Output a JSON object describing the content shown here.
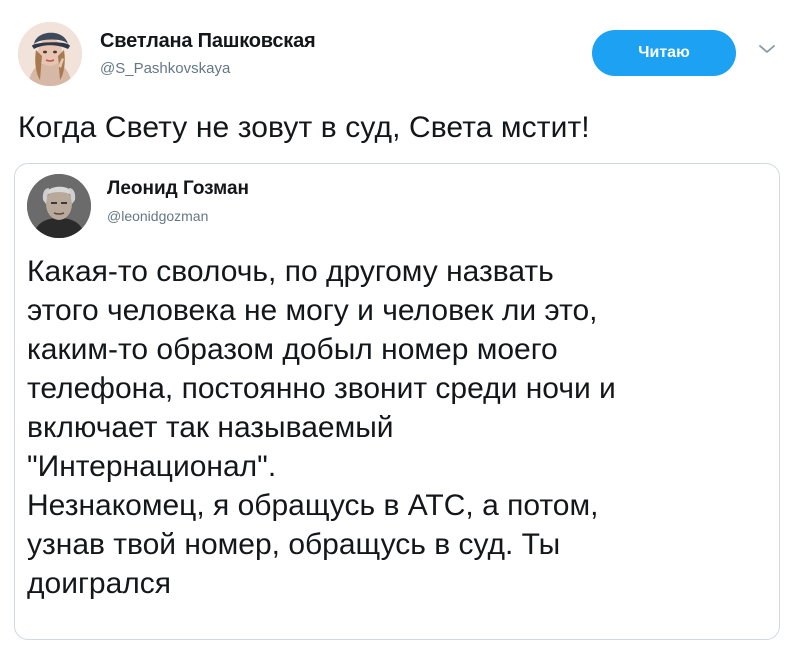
{
  "tweet": {
    "author": {
      "name": "Светлана Пашковская",
      "handle": "@S_Pashkovskaya"
    },
    "follow_button": {
      "label": "Читаю",
      "color": "#1da1f2"
    },
    "menu_icon": "chevron-down-icon",
    "text": "Когда Свету не зовут в суд, Света мстит!"
  },
  "quoted_tweet": {
    "author": {
      "name": "Леонид Гозман",
      "handle": "@leonidgozman"
    },
    "lines": [
      "Какая-то сволочь, по другому назвать",
      "этого человека не могу и человек ли это,",
      "каким-то образом добыл номер моего",
      "телефона, постоянно звонит среди ночи и",
      "включает так называемый",
      "\"Интернационал\".",
      "Незнакомец, я обращусь в АТС, а потом,",
      "узнав твой номер, обращусь в суд. Ты",
      "доигрался"
    ]
  }
}
